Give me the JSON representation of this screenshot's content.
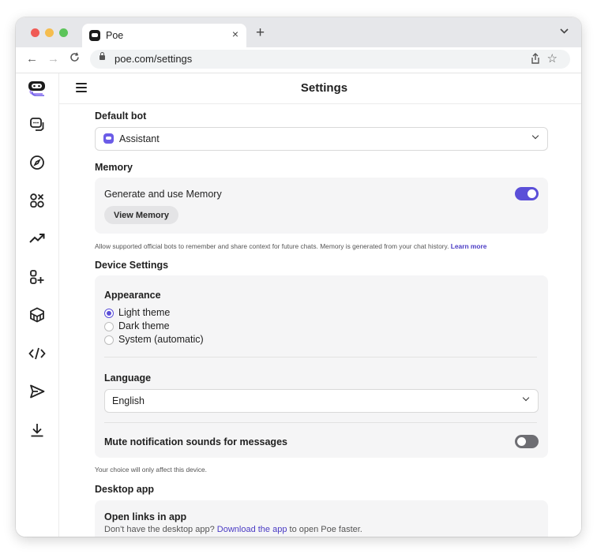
{
  "browser": {
    "tab_title": "Poe",
    "tab_close": "×",
    "new_tab": "+",
    "tab_menu": "⌄",
    "url": "poe.com/settings",
    "back": "←",
    "forward": "→",
    "reload": "C"
  },
  "app": {
    "page_title": "Settings",
    "sidebar": [
      "poe-logo-icon",
      "chats-icon",
      "explore-icon",
      "bots-icon",
      "trending-icon",
      "create-bot-icon",
      "api-icon",
      "developers-icon",
      "send-icon",
      "download-icon"
    ]
  },
  "default_bot": {
    "title": "Default bot",
    "selected": "Assistant"
  },
  "memory": {
    "title": "Memory",
    "toggle_label": "Generate and use Memory",
    "toggle_on": true,
    "view_button": "View Memory",
    "help_text": "Allow supported official bots to remember and share context for future chats. Memory is generated from your chat history.",
    "learn_more": "Learn more"
  },
  "device_settings": {
    "title": "Device Settings",
    "appearance_title": "Appearance",
    "themes": [
      "Light theme",
      "Dark theme",
      "System (automatic)"
    ],
    "selected_theme": "Light theme",
    "language_title": "Language",
    "language": "English",
    "mute_label": "Mute notification sounds for messages",
    "mute_on": false,
    "help_text": "Your choice will only affect this device."
  },
  "desktop_app": {
    "title": "Desktop app",
    "open_links_title": "Open links in app",
    "prompt_before": "Don't have the desktop app?",
    "download_link": "Download the app",
    "prompt_after": "to open Poe faster."
  },
  "colors": {
    "accent": "#5b4fd8",
    "panel": "#f5f5f6"
  }
}
